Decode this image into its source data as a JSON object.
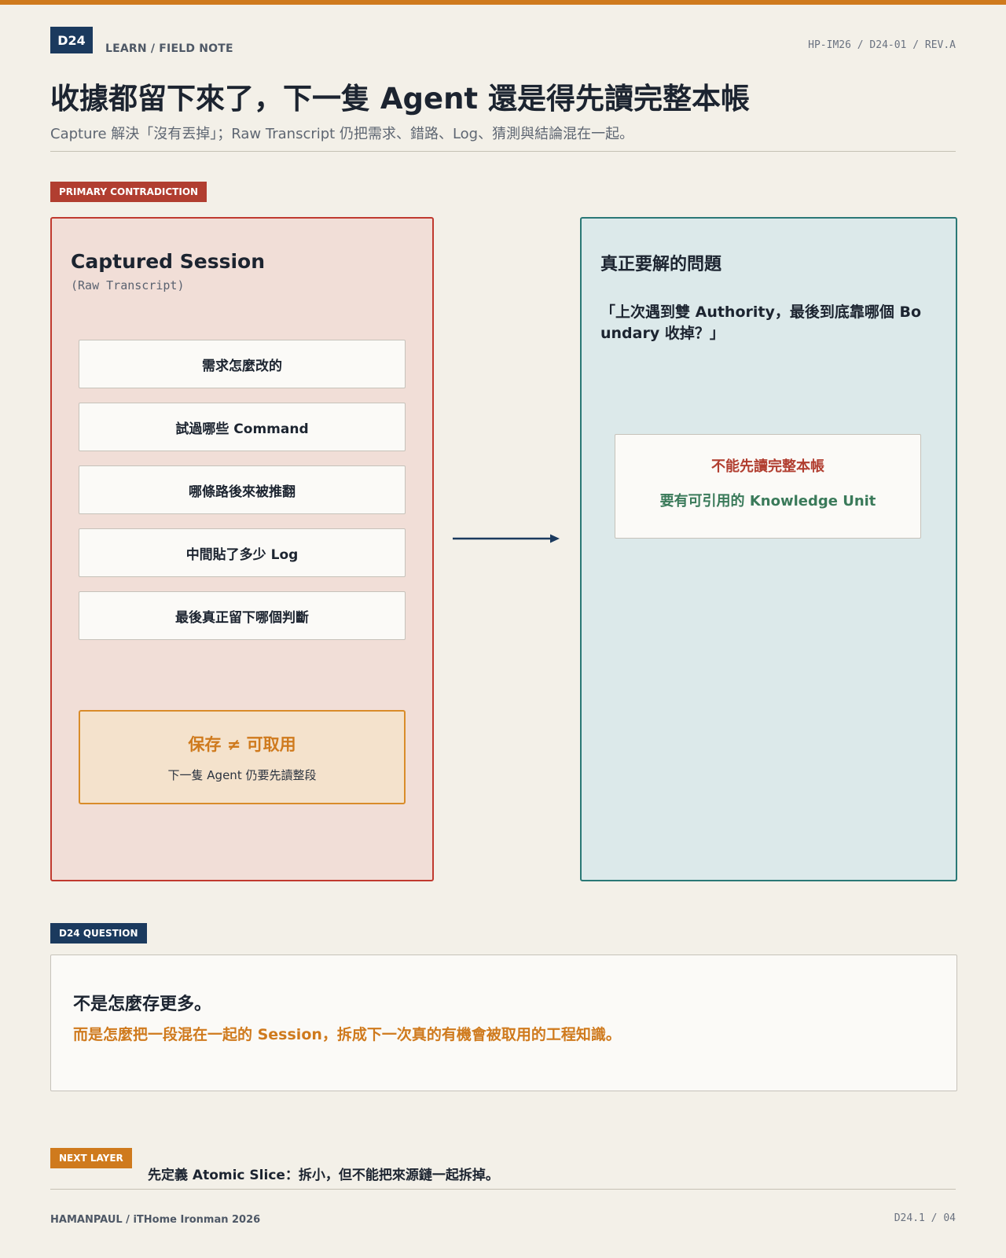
{
  "header": {
    "badge": "D24",
    "kicker": "LEARN / FIELD NOTE",
    "doc_ref": "HP-IM26 / D24-01 / REV.A",
    "title": "收據都留下來了，下一隻 Agent 還是得先讀完整本帳",
    "subtitle": "Capture 解決「沒有丟掉」；Raw Transcript 仍把需求、錯路、Log、猜測與結論混在一起。"
  },
  "section_primary": {
    "tag": "PRIMARY CONTRADICTION"
  },
  "left_panel": {
    "title": "Captured Session",
    "subtitle": "(Raw Transcript)",
    "items": [
      "需求怎麼改的",
      "試過哪些 Command",
      "哪條路後來被推翻",
      "中間貼了多少 Log",
      "最後真正留下哪個判斷"
    ],
    "callout": {
      "main": "保存 ≠ 可取用",
      "sub": "下一隻 Agent 仍要先讀整段"
    }
  },
  "right_panel": {
    "title": "真正要解的問題",
    "quote": "「上次遇到雙 Authority，最後到底靠哪個 Boundary 收掉？」",
    "result": {
      "main": "不能先讀完整本帳",
      "sub": "要有可引用的 Knowledge Unit"
    }
  },
  "question": {
    "tag": "D24 QUESTION",
    "line1": "不是怎麼存更多。",
    "line2": "而是怎麼把一段混在一起的 Session，拆成下一次真的有機會被取用的工程知識。"
  },
  "next_layer": {
    "tag": "NEXT LAYER",
    "text": "先定義 Atomic Slice：拆小，但不能把來源鏈一起拆掉。"
  },
  "footer": {
    "left": "HAMANPAUL / iTHome Ironman 2026",
    "right": "D24.1 / 04"
  },
  "colors": {
    "accent_orange": "#cf7a1d",
    "navy": "#1b3a5e",
    "red": "#b13e30",
    "teal": "#2a7876",
    "green": "#3a7a5a"
  }
}
